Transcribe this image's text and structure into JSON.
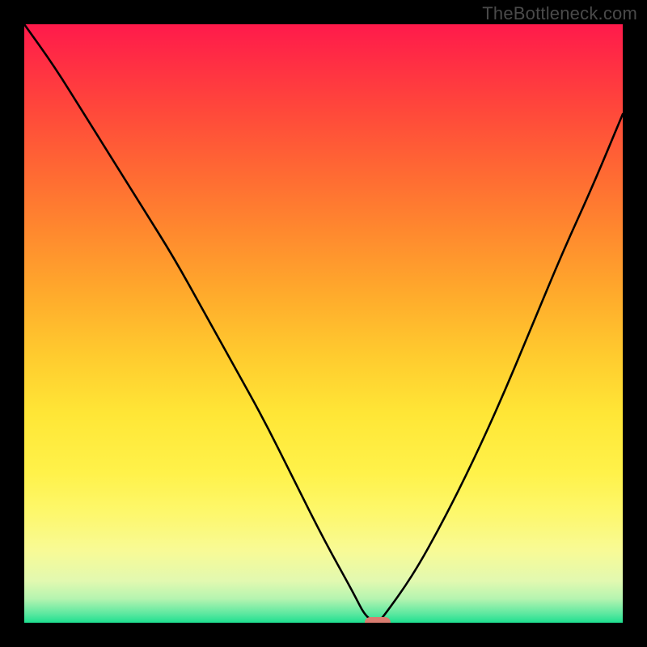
{
  "watermark": "TheBottleneck.com",
  "chart_data": {
    "type": "line",
    "title": "",
    "xlabel": "",
    "ylabel": "",
    "xlim": [
      0,
      100
    ],
    "ylim": [
      0,
      100
    ],
    "legend": false,
    "grid": false,
    "x": [
      0,
      5,
      10,
      15,
      20,
      25,
      30,
      35,
      40,
      45,
      50,
      55,
      57,
      59,
      60,
      65,
      70,
      75,
      80,
      85,
      90,
      95,
      100
    ],
    "values": [
      100,
      93,
      85,
      77,
      69,
      61,
      52,
      43,
      34,
      24,
      14,
      5,
      1,
      0,
      1,
      8,
      17,
      27,
      38,
      50,
      62,
      73,
      85
    ],
    "marker_x": 59,
    "marker_y": 0,
    "marker_color": "#d97c70",
    "background_gradient_stops": [
      {
        "offset": 0.0,
        "color": "#ff1a4b"
      },
      {
        "offset": 0.05,
        "color": "#ff2a45"
      },
      {
        "offset": 0.15,
        "color": "#ff4a3a"
      },
      {
        "offset": 0.25,
        "color": "#ff6a33"
      },
      {
        "offset": 0.35,
        "color": "#ff8a2e"
      },
      {
        "offset": 0.45,
        "color": "#ffaa2c"
      },
      {
        "offset": 0.55,
        "color": "#ffca2e"
      },
      {
        "offset": 0.65,
        "color": "#ffe636"
      },
      {
        "offset": 0.75,
        "color": "#fff24a"
      },
      {
        "offset": 0.82,
        "color": "#fdf86e"
      },
      {
        "offset": 0.88,
        "color": "#f8fa96"
      },
      {
        "offset": 0.93,
        "color": "#e2f9b0"
      },
      {
        "offset": 0.96,
        "color": "#b5f4b0"
      },
      {
        "offset": 0.985,
        "color": "#5ce8a0"
      },
      {
        "offset": 1.0,
        "color": "#1ee090"
      }
    ]
  }
}
